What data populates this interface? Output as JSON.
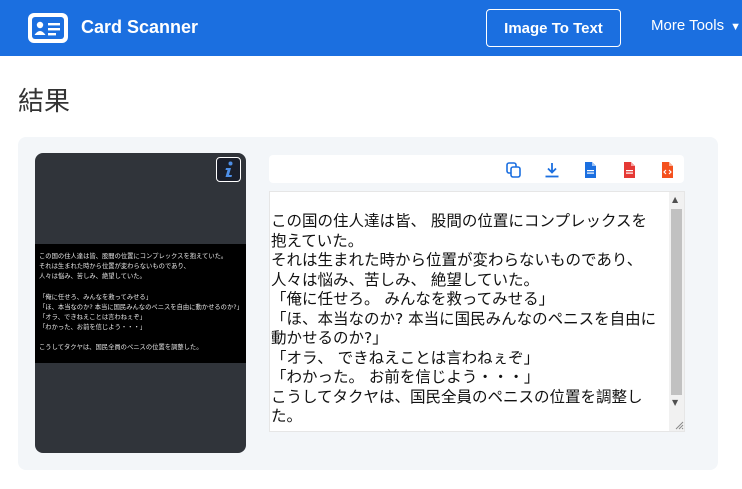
{
  "header": {
    "brand": "Card Scanner",
    "image_to_text_label": "Image To Text",
    "more_tools_label": "More Tools",
    "brand_color": "#1b6fe0"
  },
  "page": {
    "title": "結果"
  },
  "preview": {
    "lines": [
      "この国の住人達は皆、股間の位置にコンプレックスを抱えていた。",
      "それは生まれた時から位置が変わらないものであり、",
      "人々は悩み、苦しみ、絶望していた。",
      "",
      "「俺に任せろ、みんなを救ってみせる」",
      "「ほ、本当なのか? 本当に国民みんなのペニスを自由に動かせるのか?」",
      "「オラ、できねえことは言わねぇぞ」",
      "「わかった、お前を信じよう・・・」",
      "",
      "こうしてタクヤは、国民全員のペニスの位置を調整した。"
    ]
  },
  "toolbar": {
    "icons": [
      "copy-icon",
      "download-icon",
      "doc-file-icon",
      "pdf-file-icon",
      "html-file-icon"
    ]
  },
  "result": {
    "lines": [
      "この国の住人達は皆、 股間の位置にコンプレックスを",
      "抱えていた。",
      "それは生まれた時から位置が変わらないものであり、",
      "人々は悩み、苦しみ、 絶望していた。",
      "「俺に任せろ。 みんなを救ってみせる」",
      "「ほ、本当なのか? 本当に国民みんなのペニスを自由に",
      "動かせるのか?」",
      "「オラ、 できねえことは言わねぇぞ」",
      "「わかった。 お前を信じよう・・・」",
      "こうしてタクヤは、国民全員のペニスの位置を調整し",
      "た。"
    ]
  }
}
